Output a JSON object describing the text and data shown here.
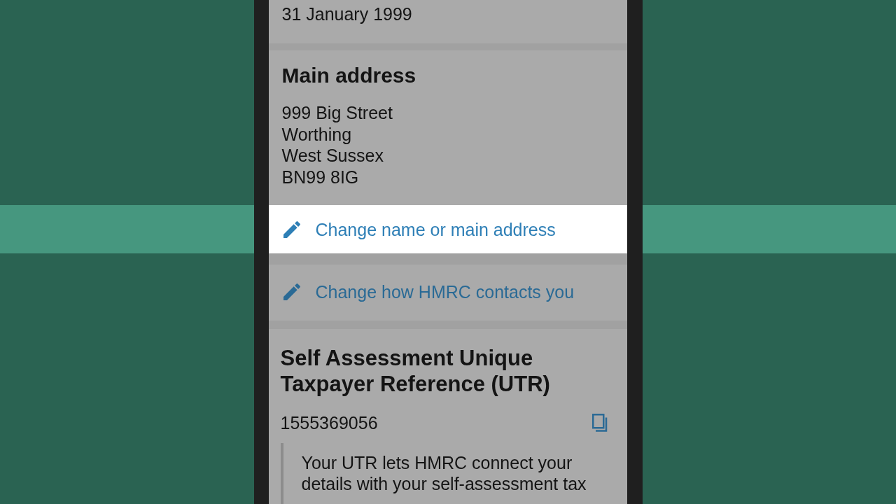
{
  "screen": {
    "top_card": {
      "value": "31 January 1999"
    },
    "main_address": {
      "heading": "Main address",
      "lines": [
        "999 Big Street",
        "Worthing",
        "West Sussex",
        "BN99 8IG"
      ]
    },
    "links": [
      {
        "label": "Change name or main address",
        "highlighted": true
      },
      {
        "label": "Change how HMRC contacts you",
        "highlighted": false
      }
    ],
    "utr": {
      "heading": "Self Assessment Unique Taxpayer Reference (UTR)",
      "value": "1555369056",
      "note": "Your UTR lets HMRC connect your details with your self-assessment tax"
    }
  }
}
